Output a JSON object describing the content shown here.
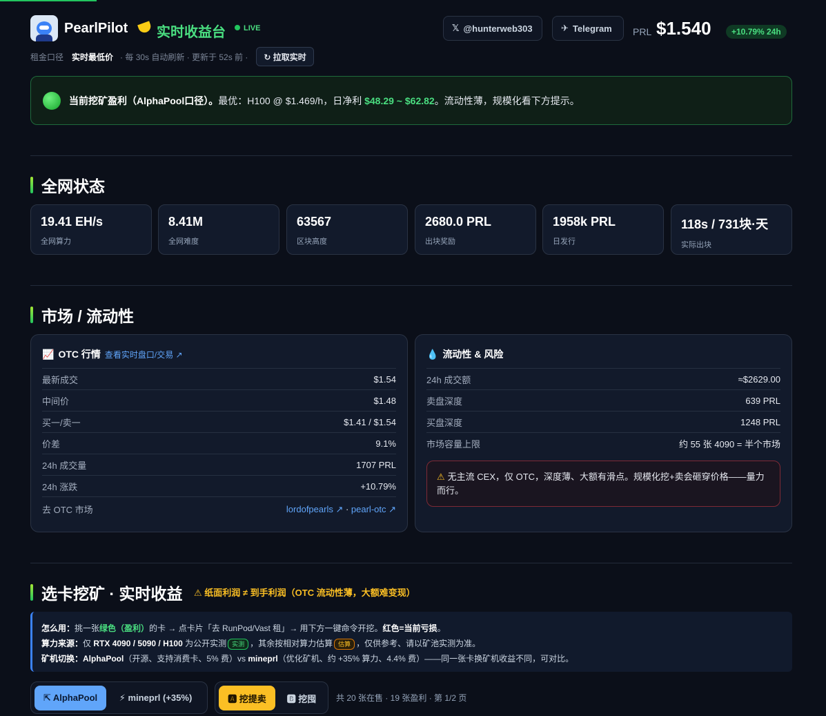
{
  "header": {
    "brand": "PearlPilot",
    "subtitle": "实时收益台",
    "live": "LIVE",
    "x_handle": "@hunterweb303",
    "x_icon": "𝕏",
    "telegram": "Telegram",
    "telegram_icon": "✈",
    "prl_label": "PRL",
    "price": "$1.540",
    "change": "+10.79% 24h"
  },
  "subbar": {
    "mode_a": "租金口径",
    "mode_b": "实时最低价",
    "refresh": "· 每 30s 自动刷新 · 更新于 52s 前 ·",
    "pull_button": "↻ 拉取实时"
  },
  "alert": {
    "lead": "当前挖矿盈利（AlphaPool口径）。",
    "mid": "最优：H100 @ $1.469/h，日净利 ",
    "range": "$48.29 ~ $62.82",
    "tail": "。流动性薄，规模化看下方提示。"
  },
  "network": {
    "title": "全网状态",
    "stats": [
      {
        "value": "19.41 EH/s",
        "label": "全网算力"
      },
      {
        "value": "8.41M",
        "label": "全网难度"
      },
      {
        "value": "63567",
        "label": "区块高度"
      },
      {
        "value": "2680.0 PRL",
        "label": "出块奖励"
      },
      {
        "value": "1958k PRL",
        "label": "日发行"
      },
      {
        "value": "118s / 731块·天",
        "label": "实际出块"
      }
    ]
  },
  "market": {
    "title": "市场 / 流动性",
    "otc": {
      "emoji": "📈",
      "title": "OTC 行情",
      "link": "查看实时盘口/交易 ↗",
      "rows": [
        {
          "k": "最新成交",
          "v": "$1.54"
        },
        {
          "k": "中间价",
          "v": "$1.48"
        },
        {
          "k": "买一/卖一",
          "v": "$1.41 / $1.54"
        },
        {
          "k": "价差",
          "v": "9.1%"
        },
        {
          "k": "24h 成交量",
          "v": "1707 PRL"
        },
        {
          "k": "24h 涨跌",
          "v": "+10.79%"
        }
      ],
      "market_link_label": "去 OTC 市场",
      "market_link_a": "lordofpearls ↗",
      "market_link_sep": " · ",
      "market_link_b": "pearl-otc ↗"
    },
    "liquidity": {
      "emoji": "💧",
      "title": "流动性 & 风险",
      "rows": [
        {
          "k": "24h 成交额",
          "v": "≈$2629.00"
        },
        {
          "k": "卖盘深度",
          "v": "639 PRL"
        },
        {
          "k": "买盘深度",
          "v": "1248 PRL"
        },
        {
          "k": "市场容量上限",
          "v": "约 55 张 4090 = 半个市场"
        }
      ],
      "warning_icon": "⚠",
      "warning": "无主流 CEX，仅 OTC，深度薄、大额有滑点。规模化挖+卖会砸穿价格——量力而行。"
    }
  },
  "mining": {
    "title": "选卡挖矿 · 实时收益",
    "note_icon": "⚠",
    "note": "纸面利润 ≠ 到手利润（OTC 流动性薄，大额难变现）",
    "guide": {
      "l1_label": "怎么用：",
      "l1_a": "挑一张",
      "l1_green": "绿色（盈利）",
      "l1_b": "的卡 → 点卡片「去 RunPod/Vast 租」→ 用下方一键命令开挖。",
      "l1_red": "红色=当前亏损",
      "l1_end": "。",
      "l2_label": "算力来源：",
      "l2_a": "仅 ",
      "l2_cards": "RTX 4090 / 5090 / H100",
      "l2_b": " 为公开实测",
      "l2_tag1": "实测",
      "l2_c": "，其余按相对算力估算",
      "l2_tag2": "估算",
      "l2_d": "，仅供参考、请以矿池实测为准。",
      "l3_label": "矿机切换：",
      "l3_pool_a": "AlphaPool",
      "l3_a": "（开源、支持消费卡、5% 费）vs ",
      "l3_pool_b": "mineprl",
      "l3_b": "（优化矿机、约 +35% 算力、4.4% 费）——同一张卡换矿机收益不同，可对比。"
    },
    "pool_a": "⇱ AlphaPool",
    "pool_b": "⚡ mineprl (+35%)",
    "sort_a": "🅰 挖提卖",
    "sort_b": "🅱 挖囤",
    "count": "共 20 张在售 · 19 张盈利 · 第 1/2 页"
  }
}
